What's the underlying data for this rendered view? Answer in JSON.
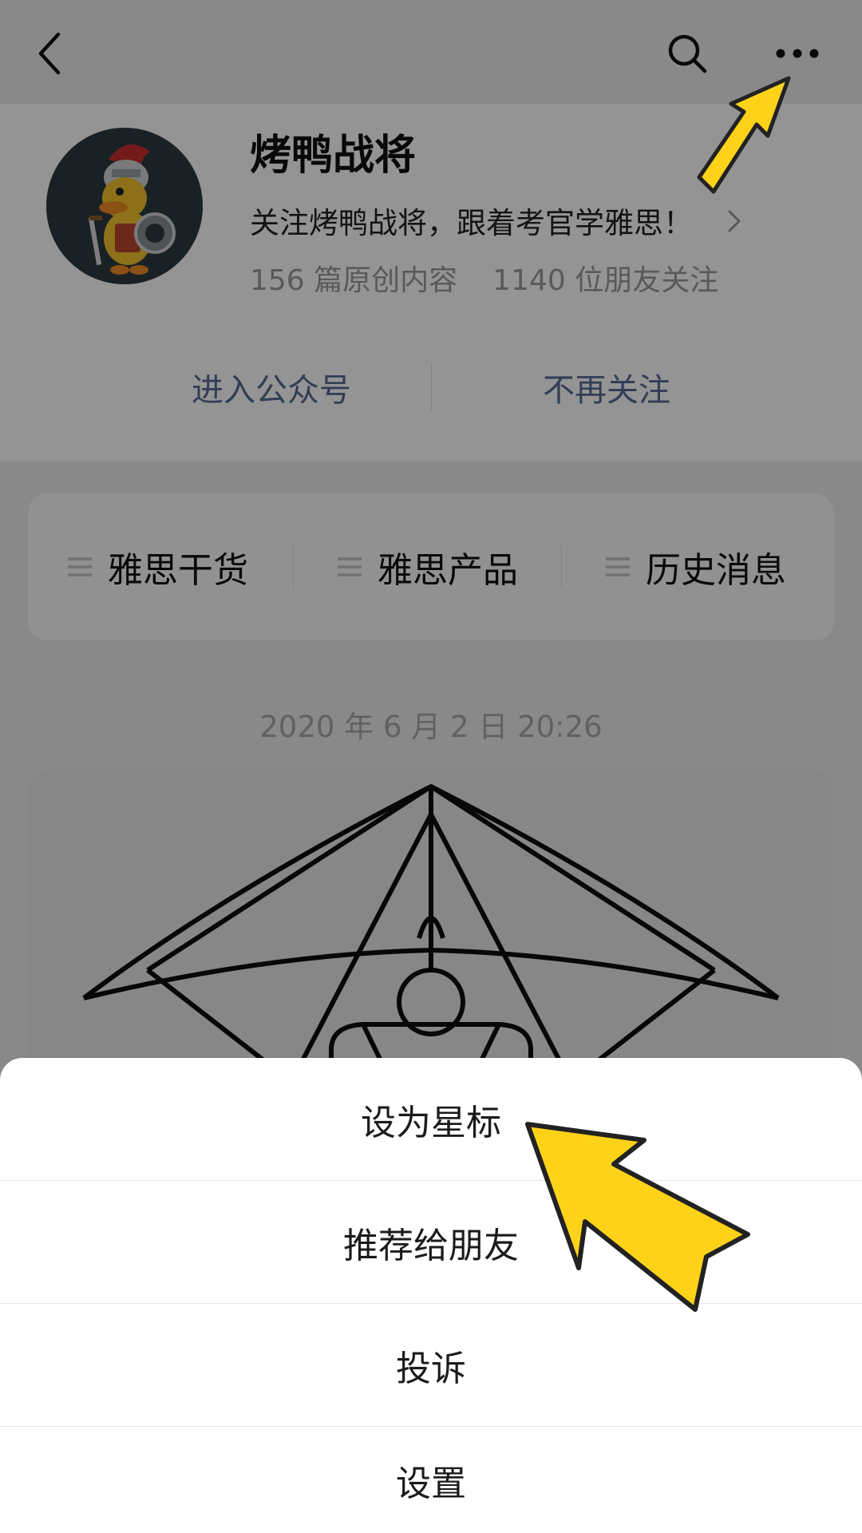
{
  "account": {
    "name": "烤鸭战将",
    "intro": "关注烤鸭战将，跟着考官学雅思！",
    "stats": {
      "articles": "156 篇原创内容",
      "followers": "1140 位朋友关注"
    }
  },
  "actions": {
    "enter": "进入公众号",
    "unfollow": "不再关注"
  },
  "menu": [
    {
      "label": "雅思干货"
    },
    {
      "label": "雅思产品"
    },
    {
      "label": "历史消息"
    }
  ],
  "timestamp": "2020 年 6 月 2 日  20:26",
  "sheet": {
    "options": [
      "设为星标",
      "推荐给朋友",
      "投诉",
      "设置"
    ]
  },
  "watermark": "烤鸭战将",
  "icons": {
    "back": "back-arrow-icon",
    "search": "search-icon",
    "more": "more-dots-icon"
  },
  "colors": {
    "link": "#576b95",
    "highlight_arrow": "#ffd21a",
    "overlay": "rgba(0,0,0,0.42)"
  }
}
